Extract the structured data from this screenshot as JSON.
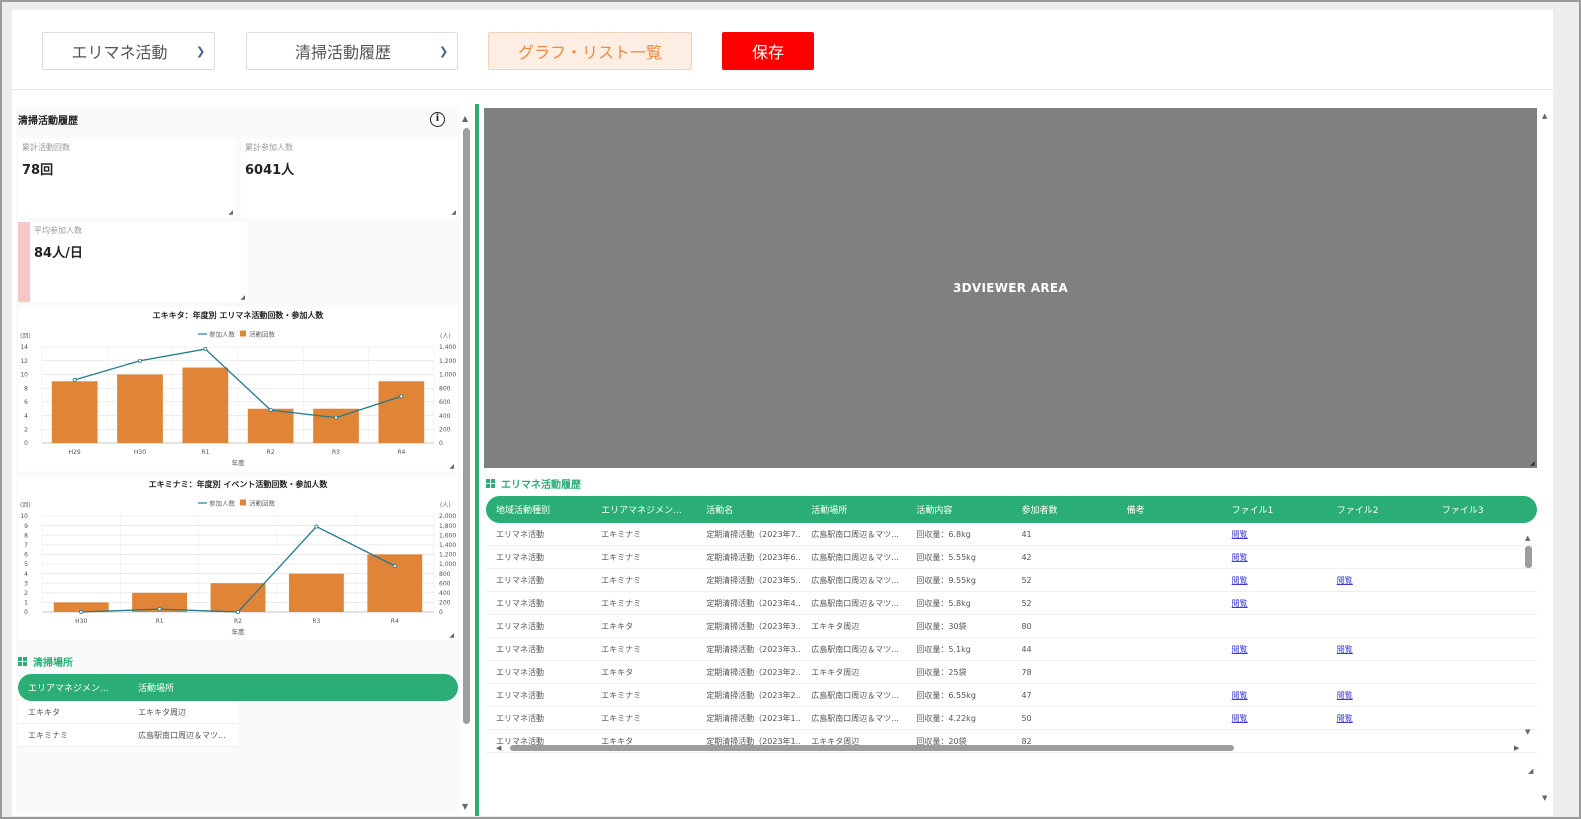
{
  "toolbar": {
    "category_select": "エリマネ活動",
    "history_select": "清掃活動履歴",
    "graph_list_button": "グラフ・リスト一覧",
    "save_button": "保存"
  },
  "left_panel": {
    "title": "清掃活動履歴",
    "cards": [
      {
        "label": "累計活動回数",
        "value": "78回"
      },
      {
        "label": "累計参加人数",
        "value": "6041人"
      },
      {
        "label": "平均参加人数",
        "value": "84人/日"
      }
    ],
    "cleaning_places": {
      "title": "清掃場所",
      "columns": [
        "エリアマネジメン...",
        "活動場所"
      ],
      "rows": [
        [
          "エキキタ",
          "エキキタ周辺"
        ],
        [
          "エキミナミ",
          "広島駅南口周辺＆マツ..."
        ]
      ]
    }
  },
  "chart_data": [
    {
      "type": "bar",
      "title": "エキキタ：年度別 エリマネ活動回数・参加人数",
      "categories": [
        "H29",
        "H30",
        "R1",
        "R2",
        "R3",
        "R4"
      ],
      "xlabel": "年度",
      "ylabel_left": "(回)",
      "ylabel_right": "(人)",
      "ylim_left": [
        0,
        14
      ],
      "ylim_right": [
        0,
        1400
      ],
      "left_ticks": [
        "0",
        "2",
        "4",
        "6",
        "8",
        "10",
        "12",
        "14"
      ],
      "right_ticks": [
        "0",
        "200",
        "400",
        "600",
        "800",
        "1,000",
        "1,200",
        "1,400"
      ],
      "legend": [
        "参加人数",
        "活動回数"
      ],
      "legend_position": "top-center",
      "series": [
        {
          "name": "活動回数",
          "type": "bar",
          "axis": "left",
          "values": [
            9,
            10,
            11,
            5,
            5,
            9
          ],
          "color": "#e08537"
        },
        {
          "name": "参加人数",
          "type": "line",
          "axis": "right",
          "values": [
            920,
            1200,
            1370,
            480,
            370,
            680
          ],
          "color": "#1f7a8c"
        }
      ]
    },
    {
      "type": "bar",
      "title": "エキミナミ：年度別 イベント活動回数・参加人数",
      "categories": [
        "H30",
        "R1",
        "R2",
        "R3",
        "R4"
      ],
      "xlabel": "年度",
      "ylabel_left": "(回)",
      "ylabel_right": "(人)",
      "ylim_left": [
        0,
        10
      ],
      "ylim_right": [
        0,
        2000
      ],
      "left_ticks": [
        "0",
        "1",
        "2",
        "3",
        "4",
        "5",
        "6",
        "7",
        "8",
        "9",
        "10"
      ],
      "right_ticks": [
        "0",
        "200",
        "400",
        "600",
        "800",
        "1,000",
        "1,200",
        "1,400",
        "1,600",
        "1,800",
        "2,000"
      ],
      "legend": [
        "参加人数",
        "活動回数"
      ],
      "legend_position": "top-center",
      "series": [
        {
          "name": "活動回数",
          "type": "bar",
          "axis": "left",
          "values": [
            1,
            2,
            3,
            4,
            6
          ],
          "color": "#e08537"
        },
        {
          "name": "参加人数",
          "type": "line",
          "axis": "right",
          "values": [
            0,
            60,
            0,
            1780,
            960
          ],
          "color": "#1f7a8c"
        }
      ]
    }
  ],
  "viewer": {
    "label": "3DVIEWER AREA"
  },
  "activity_table": {
    "title": "エリマネ活動履歴",
    "columns": [
      "地域活動種別",
      "エリアマネジメン...",
      "活動名",
      "活動場所",
      "活動内容",
      "参加者数",
      "備考",
      "ファイル1",
      "ファイル2",
      "ファイル3"
    ],
    "rows": [
      [
        "エリマネ活動",
        "エキミナミ",
        "定期清掃活動（2023年7...",
        "広島駅南口周辺＆マツ...",
        "回収量：6.8kg",
        "41",
        "",
        "閲覧",
        "",
        ""
      ],
      [
        "エリマネ活動",
        "エキミナミ",
        "定期清掃活動（2023年6...",
        "広島駅南口周辺＆マツ...",
        "回収量：5.55kg",
        "42",
        "",
        "閲覧",
        "",
        ""
      ],
      [
        "エリマネ活動",
        "エキミナミ",
        "定期清掃活動（2023年5...",
        "広島駅南口周辺＆マツ...",
        "回収量：9.55kg",
        "52",
        "",
        "閲覧",
        "閲覧",
        ""
      ],
      [
        "エリマネ活動",
        "エキミナミ",
        "定期清掃活動（2023年4...",
        "広島駅南口周辺＆マツ...",
        "回収量：5.8kg",
        "52",
        "",
        "閲覧",
        "",
        ""
      ],
      [
        "エリマネ活動",
        "エキキタ",
        "定期清掃活動（2023年3...",
        "エキキタ周辺",
        "回収量：30袋",
        "80",
        "",
        "",
        "",
        ""
      ],
      [
        "エリマネ活動",
        "エキミナミ",
        "定期清掃活動（2023年3...",
        "広島駅南口周辺＆マツ...",
        "回収量：5.1kg",
        "44",
        "",
        "閲覧",
        "閲覧",
        ""
      ],
      [
        "エリマネ活動",
        "エキキタ",
        "定期清掃活動（2023年2...",
        "エキキタ周辺",
        "回収量：25袋",
        "78",
        "",
        "",
        "",
        ""
      ],
      [
        "エリマネ活動",
        "エキミナミ",
        "定期清掃活動（2023年2...",
        "広島駅南口周辺＆マツ...",
        "回収量：6.55kg",
        "47",
        "",
        "閲覧",
        "閲覧",
        ""
      ],
      [
        "エリマネ活動",
        "エキミナミ",
        "定期清掃活動（2023年1...",
        "広島駅南口周辺＆マツ...",
        "回収量：4.22kg",
        "50",
        "",
        "閲覧",
        "閲覧",
        ""
      ],
      [
        "エリマネ活動",
        "エキキタ",
        "定期清掃活動（2023年1...",
        "エキキタ周辺",
        "回収量：20袋",
        "82",
        "",
        "",
        "",
        ""
      ]
    ]
  }
}
